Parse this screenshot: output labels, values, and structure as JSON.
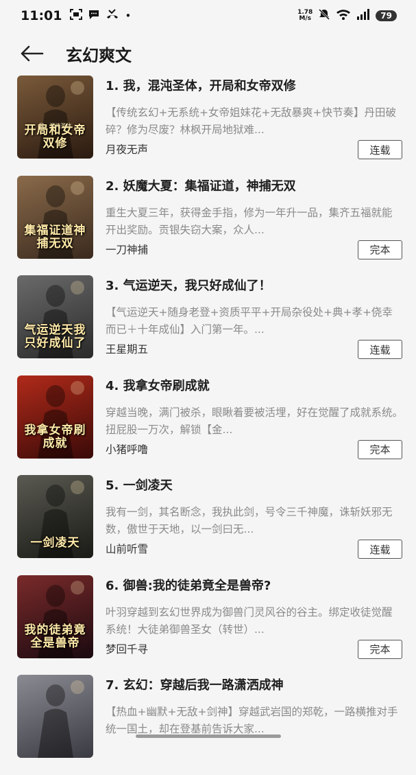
{
  "status_bar": {
    "time": "11:01",
    "net_speed_value": "1.78",
    "net_speed_unit": "M/s",
    "battery": "79"
  },
  "header": {
    "title": "玄幻爽文"
  },
  "books": [
    {
      "title": "1. 我，混沌圣体，开局和女帝双修",
      "description": "【传统玄幻+无系统+女帝姐妹花+无敌暴爽+快节奏】丹田破碎？修为尽废？林枫开局地狱难...",
      "author": "月夜无声",
      "status": "连载",
      "cover_text": "开局和女帝双修",
      "cover_top": "我，混沌圣体",
      "cover_colors": [
        "#7a5a3a",
        "#2a1a10"
      ]
    },
    {
      "title": "2. 妖魔大夏：集福证道，神捕无双",
      "description": "重生大夏三年，获得金手指，修为一年升一品，集齐五福就能开出奖励。贡银失窃大案，众人...",
      "author": "一刀神捕",
      "status": "完本",
      "cover_text": "集福证道神捕无双",
      "cover_top": "",
      "cover_colors": [
        "#8a6a4a",
        "#3a2a1e"
      ]
    },
    {
      "title": "3. 气运逆天，我只好成仙了！",
      "description": "【气运逆天+随身老登+资质平平+开局杂役处+典+孝+侥幸而已＋十年成仙】入门第一年。...",
      "author": "王星期五",
      "status": "连载",
      "cover_text": "气运逆天我只好成仙了",
      "cover_top": "",
      "cover_colors": [
        "#6a6a6a",
        "#2a2a2a"
      ]
    },
    {
      "title": "4. 我拿女帝刷成就",
      "description": "穿越当晚，满门被杀，眼瞅着要被活埋，好在觉醒了成就系统。　　扭屁股一万次，解锁【金...",
      "author": "小猪呼噜",
      "status": "完本",
      "cover_text": "我拿女帝刷成就",
      "cover_top": "",
      "cover_colors": [
        "#b02a1a",
        "#3a0a08"
      ]
    },
    {
      "title": "5. 一剑凌天",
      "description": "我有一剑，其名断念，我执此剑，号令三千神魔，诛斩妖邪无数，傲世于天地，以一剑曰无...",
      "author": "山前听雪",
      "status": "连载",
      "cover_text": "一剑凌天",
      "cover_top": "",
      "cover_colors": [
        "#5a5a52",
        "#1a1a16"
      ]
    },
    {
      "title": "6. 御兽:我的徒弟竟全是兽帝?",
      "description": "叶羽穿越到玄幻世界成为御兽门灵风谷的谷主。绑定收徒觉醒系统！大徒弟御兽圣女（转世）...",
      "author": "梦回千寻",
      "status": "完本",
      "cover_text": "我的徒弟竟全是兽帝",
      "cover_top": "",
      "cover_colors": [
        "#7a2a2a",
        "#1a0a10"
      ]
    },
    {
      "title": "7. 玄幻：穿越后我一路潇洒成神",
      "description": "【热血+幽默+无敌+剑神】穿越武岩国的郑乾，一路横推对手统一国土，却在登基前告诉大家...",
      "author": "",
      "status": "",
      "cover_text": "",
      "cover_top": "",
      "cover_colors": [
        "#8a8a92",
        "#3a3a42"
      ]
    }
  ]
}
